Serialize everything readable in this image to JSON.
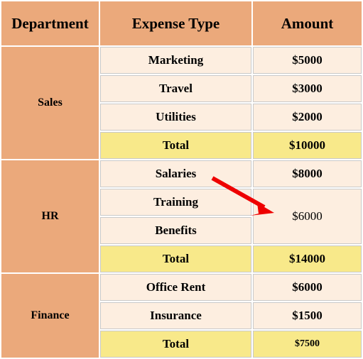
{
  "table": {
    "columns": [
      "Department",
      "Expense Type",
      "Amount"
    ],
    "sections": [
      {
        "department": "Sales",
        "rows": [
          {
            "type": "Marketing",
            "amount": "$5000"
          },
          {
            "type": "Travel",
            "amount": "$3000"
          },
          {
            "type": "Utilities",
            "amount": "$2000"
          }
        ],
        "total_label": "Total",
        "total_amount": "$10000"
      },
      {
        "department": "HR",
        "rows": [
          {
            "type": "Salaries",
            "amount": "$8000"
          },
          {
            "type": "Training",
            "amount": "$6000"
          },
          {
            "type": "Benefits",
            "amount": ""
          }
        ],
        "total_label": "Total",
        "total_amount": "$14000"
      },
      {
        "department": "Finance",
        "rows": [
          {
            "type": "Office Rent",
            "amount": "$6000"
          },
          {
            "type": "Insurance",
            "amount": "$1500"
          }
        ],
        "total_label": "Total",
        "total_amount": "$7500"
      }
    ]
  },
  "annotation": {
    "arrow_color": "#ee0000",
    "points_to": "$6000"
  },
  "colors": {
    "header_background": "#eba97b",
    "department_background": "#eba97b",
    "cell_background": "#fdeee0",
    "total_background": "#f8e98a",
    "grid_line": "#c9c9c9",
    "text": "#000000"
  }
}
